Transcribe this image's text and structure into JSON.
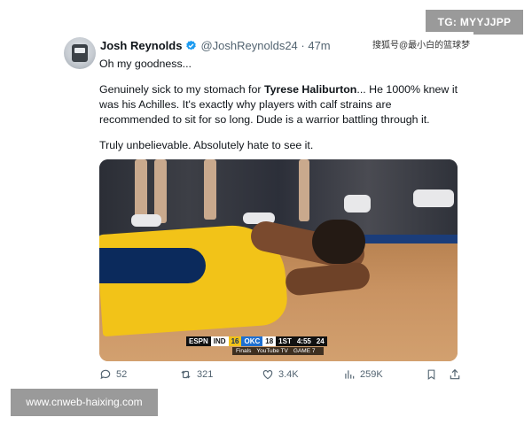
{
  "overlays": {
    "tg_badge": "TG: MYYJJPP",
    "web_badge": "www.cnweb-haixing.com",
    "cn_watermark": "搜狐号@最小白的篮球梦"
  },
  "tweet": {
    "author_name": "Josh Reynolds",
    "handle_time": "@JoshReynolds24 · 47m",
    "line1": "Oh my goodness...",
    "para2_prefix": "Genuinely sick to my stomach for ",
    "para2_bold": "Tyrese Haliburton",
    "para2_suffix": "... He 1000% knew it was his Achilles. It's exactly why players with calf strains are recommended to sit for so long. Dude is a warrior battling through it.",
    "line3": "Truly unbelievable. Absolutely hate to see it.",
    "verified_color": "#1d9bf0"
  },
  "scorebug": {
    "network": "ESPN",
    "team1": "IND",
    "team1_score": "16",
    "team2": "OKC",
    "team2_score": "18",
    "period": "1ST",
    "clock": "4:55",
    "shot_clock": "24",
    "sub_finals": "Finals",
    "sub_tv": "YouTube TV",
    "sub_game": "GAME 7"
  },
  "actions": {
    "replies": "52",
    "reposts": "321",
    "likes": "3.4K",
    "views": "259K"
  }
}
